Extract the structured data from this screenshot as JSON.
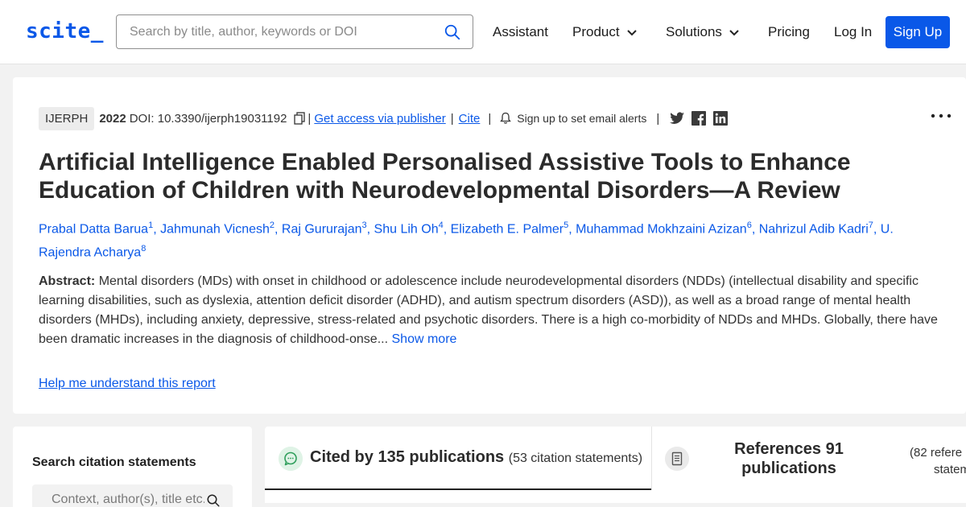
{
  "header": {
    "logo": "scite_",
    "search_placeholder": "Search by title, author, keywords or DOI",
    "nav": {
      "assistant": "Assistant",
      "product": "Product",
      "solutions": "Solutions",
      "pricing": "Pricing",
      "login": "Log In",
      "signup": "Sign Up"
    },
    "accent_color": "#0a58e8"
  },
  "article": {
    "journal": "IJERPH",
    "year": "2022",
    "doi": "DOI: 10.3390/ijerph19031192",
    "sep": "|",
    "access_link": "Get access via publisher",
    "cite_link": "Cite",
    "alert_text": "Sign up to set email alerts",
    "more": "⋮",
    "title": "Artificial Intelligence Enabled Personalised Assistive Tools to Enhance Education of Children with Neurodevelopmental Disorders—A Review",
    "authors": [
      {
        "name": "Prabal Datta Barua",
        "sup": "1"
      },
      {
        "name": "Jahmunah Vicnesh",
        "sup": "2"
      },
      {
        "name": "Raj Gururajan",
        "sup": "3"
      },
      {
        "name": "Shu Lih Oh",
        "sup": "4"
      },
      {
        "name": "Elizabeth E. Palmer",
        "sup": "5"
      },
      {
        "name": "Muhammad Mokhzaini Azizan",
        "sup": "6"
      },
      {
        "name": "Nahrizul Adib Kadri",
        "sup": "7"
      },
      {
        "name": "U. Rajendra Acharya",
        "sup": "8"
      }
    ],
    "abstract_label": "Abstract:",
    "abstract_text": "Mental disorders (MDs) with onset in childhood or adolescence include neurodevelopmental disorders (NDDs) (intellectual disability and specific learning disabilities, such as dyslexia, attention deficit disorder (ADHD), and autism spectrum disorders (ASD)), as well as a broad range of mental health disorders (MHDs), including anxiety, depressive, stress-related and psychotic disorders. There is a high co-morbidity of NDDs and MHDs. Globally, there have been dramatic increases in the diagnosis of childhood-onse...",
    "show_more": "Show more",
    "help_link": "Help me understand this report"
  },
  "sidebar": {
    "title": "Search citation statements",
    "placeholder": "Context, author(s), title etc."
  },
  "tabs": {
    "cited_by": "Cited by 135 publications",
    "cited_by_sub": "(53 citation statements)",
    "references": "References 91 publications",
    "references_sub_1": "(82 refere",
    "references_sub_2": "stateme"
  }
}
